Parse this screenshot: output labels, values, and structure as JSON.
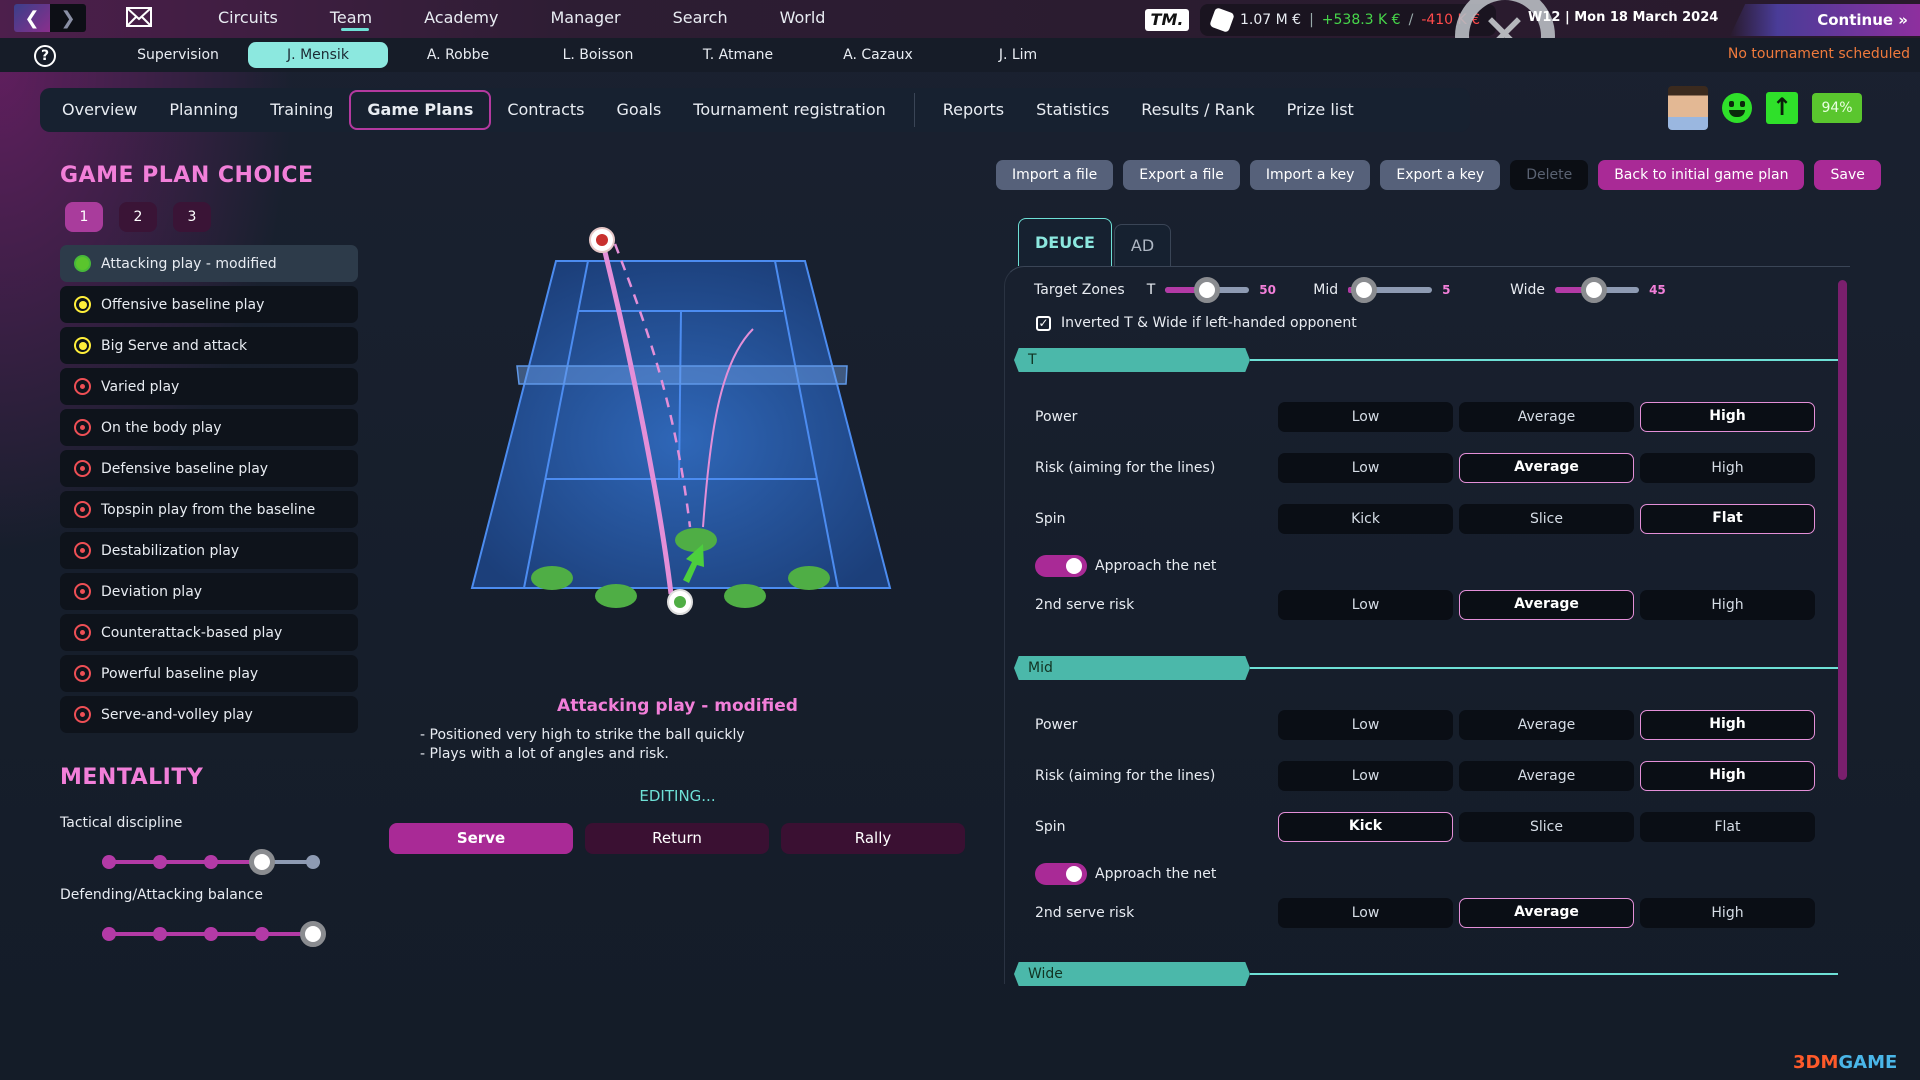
{
  "topbar": {
    "nav_items": [
      "Circuits",
      "Team",
      "Academy",
      "Manager",
      "Search",
      "World"
    ],
    "active_nav": "Team",
    "logo": "TM.",
    "balance": "1.07 M €",
    "income": "+538.3 K €",
    "expenses": "-410 K €",
    "date": "W12 | Mon 18 March 2024",
    "continue_label": "Continue",
    "tournament_status": "No tournament scheduled"
  },
  "players": {
    "items": [
      "Supervision",
      "J. Mensik",
      "A. Robbe",
      "L. Boisson",
      "T. Atmane",
      "A. Cazaux",
      "J. Lim"
    ],
    "active": "J. Mensik"
  },
  "subtabs": {
    "items": [
      "Overview",
      "Planning",
      "Training",
      "Game Plans",
      "Contracts",
      "Goals",
      "Tournament registration",
      "Reports",
      "Statistics",
      "Results / Rank",
      "Prize list"
    ],
    "active": "Game Plans"
  },
  "player_status": {
    "morale_icon": "happy-smiley-icon",
    "form_icon": "arrow-up-icon",
    "fitness": "94%"
  },
  "game_plan_choice": {
    "title": "GAME PLAN CHOICE",
    "slots": [
      "1",
      "2",
      "3"
    ],
    "active_slot": "1",
    "plans": [
      {
        "label": "Attacking play - modified",
        "status": "green",
        "active": true
      },
      {
        "label": "Offensive baseline play",
        "status": "yellow"
      },
      {
        "label": "Big Serve and attack",
        "status": "yellow"
      },
      {
        "label": "Varied play",
        "status": "red"
      },
      {
        "label": "On the body play",
        "status": "red"
      },
      {
        "label": "Defensive baseline play",
        "status": "red"
      },
      {
        "label": "Topspin play from the baseline",
        "status": "red"
      },
      {
        "label": "Destabilization play",
        "status": "red"
      },
      {
        "label": "Deviation play",
        "status": "red"
      },
      {
        "label": "Counterattack-based play",
        "status": "red"
      },
      {
        "label": "Powerful baseline play",
        "status": "red"
      },
      {
        "label": "Serve-and-volley play",
        "status": "red"
      }
    ],
    "status_colors": {
      "green": "#5ac52d",
      "yellow": "#ffef3a",
      "red": "#ee4f55"
    }
  },
  "mentality": {
    "title": "MENTALITY",
    "sliders": [
      {
        "label": "Tactical discipline",
        "value": 4,
        "steps": 5
      },
      {
        "label": "Defending/Attacking balance",
        "value": 5,
        "steps": 5
      }
    ]
  },
  "plan_description": {
    "title": "Attacking play - modified",
    "lines": [
      "- Positioned very high to strike the ball quickly",
      "- Plays with a lot of angles and risk."
    ],
    "editing_label": "EDITING..."
  },
  "modes": {
    "items": [
      "Serve",
      "Return",
      "Rally"
    ],
    "active": "Serve"
  },
  "actions": {
    "import_file": "Import a file",
    "export_file": "Export a file",
    "import_key": "Import a key",
    "export_key": "Export a key",
    "delete": "Delete",
    "back_initial": "Back to initial game plan",
    "save": "Save"
  },
  "side_tabs": {
    "items": [
      "DEUCE",
      "AD"
    ],
    "active": "DEUCE"
  },
  "target_zones": {
    "label": "Target Zones",
    "zones": [
      {
        "name": "T",
        "value": 50
      },
      {
        "name": "Mid",
        "value": 5
      },
      {
        "name": "Wide",
        "value": 45
      }
    ],
    "inverted_label": "Inverted T & Wide if left-handed opponent",
    "inverted_checked": true
  },
  "sections": [
    {
      "name": "T",
      "rows": [
        {
          "label": "Power",
          "options": [
            "Low",
            "Average",
            "High"
          ],
          "selected": "High"
        },
        {
          "label": "Risk (aiming for the lines)",
          "options": [
            "Low",
            "Average",
            "High"
          ],
          "selected": "Average"
        },
        {
          "label": "Spin",
          "options": [
            "Kick",
            "Slice",
            "Flat"
          ],
          "selected": "Flat"
        }
      ],
      "approach_net_label": "Approach the net",
      "approach_net": true,
      "second_serve": {
        "label": "2nd serve risk",
        "options": [
          "Low",
          "Average",
          "High"
        ],
        "selected": "Average"
      }
    },
    {
      "name": "Mid",
      "rows": [
        {
          "label": "Power",
          "options": [
            "Low",
            "Average",
            "High"
          ],
          "selected": "High"
        },
        {
          "label": "Risk (aiming for the lines)",
          "options": [
            "Low",
            "Average",
            "High"
          ],
          "selected": "High"
        },
        {
          "label": "Spin",
          "options": [
            "Kick",
            "Slice",
            "Flat"
          ],
          "selected": "Kick"
        }
      ],
      "approach_net_label": "Approach the net",
      "approach_net": true,
      "second_serve": {
        "label": "2nd serve risk",
        "options": [
          "Low",
          "Average",
          "High"
        ],
        "selected": "Average"
      }
    },
    {
      "name": "Wide"
    }
  ],
  "watermark": {
    "part1": "3DM",
    "part2": "GAME"
  },
  "colors": {
    "accent": "#a92a96",
    "teal": "#6ee0d6",
    "pink_title": "#f27fd9"
  }
}
